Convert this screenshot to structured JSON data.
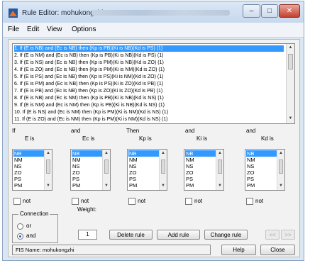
{
  "window": {
    "title": "Rule Editor: mohukongzhi"
  },
  "controls": {
    "minimize": "–",
    "maximize": "□",
    "close": "✕"
  },
  "menu": [
    "File",
    "Edit",
    "View",
    "Options"
  ],
  "rules": [
    "1. If (E is NB) and (Ec is NB) then (Kp is PB)(Ki is NB)(Kd is PS) (1)",
    "2. If (E is NM) and (Ec is NB) then (Kp is PB)(Ki is NB)(Kd is PS) (1)",
    "3. If (E is NS) and (Ec is NB) then (Kp is PM)(Ki is NB)(Kd is ZO) (1)",
    "4. If (E is ZO) and (Ec is NB) then (Kp is PM)(Ki is NM)(Kd is ZO) (1)",
    "5. If (E is PS) and (Ec is NB) then (Kp is PS)(Ki is NM)(Kd is ZO) (1)",
    "6. If (E is PM) and (Ec is NB) then (Kp is PS)(Ki is ZO)(Kd is PB) (1)",
    "7. If (E is PB) and (Ec is NB) then (Kp is ZO)(Ki is ZO)(Kd is PB) (1)",
    "8. If (E is NB) and (Ec is NM) then (Kp is PB)(Ki is NB)(Kd is NS) (1)",
    "9. If (E is NM) and (Ec is NM) then (Kp is PB)(Ki is NB)(Kd is NS) (1)",
    "10. If (E is NS) and (Ec is NM) then (Kp is PM)(Ki is NM)(Kd is NS) (1)",
    "11. If (E is ZO) and (Ec is NM) then (Kp is PM)(Ki is NM)(Kd is NS) (1)"
  ],
  "selected_rule": 0,
  "headers": {
    "if": "If",
    "and1": "and",
    "then": "Then",
    "and2": "and",
    "and3": "and",
    "e": "E is",
    "ec": "Ec is",
    "kp": "Kp is",
    "ki": "Ki is",
    "kd": "Kd is"
  },
  "lists": {
    "e": [
      "NB",
      "NM",
      "NS",
      "ZO",
      "PS",
      "PM"
    ],
    "ec": [
      "NB",
      "NM",
      "NS",
      "ZO",
      "PS",
      "PM"
    ],
    "kp": [
      "NB",
      "NM",
      "NS",
      "ZO",
      "PS",
      "PM"
    ],
    "ki": [
      "NB",
      "NM",
      "NS",
      "ZO",
      "PS",
      "PM"
    ],
    "kd": [
      "NB",
      "NM",
      "NS",
      "ZO",
      "PS",
      "PM"
    ]
  },
  "not_label": "not",
  "connection": {
    "title": "Connection",
    "or": "or",
    "and": "and",
    "selected": "and"
  },
  "weight": {
    "label": "Weight:",
    "value": "1"
  },
  "buttons": {
    "delete": "Delete rule",
    "add": "Add rule",
    "change": "Change rule",
    "prev": "<<",
    "next": ">>",
    "help": "Help",
    "close": "Close"
  },
  "status": "FIS Name: mohukongzhi"
}
